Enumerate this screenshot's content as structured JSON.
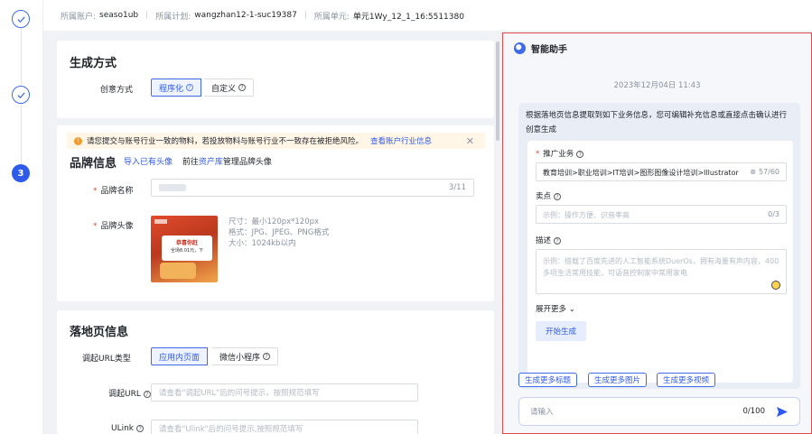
{
  "topbar": {
    "account_label": "所属账户:",
    "account_value": "seaso1ub",
    "plan_label": "所属计划:",
    "plan_value": "wangzhan12-1-suc19387",
    "unit_label": "所属单元:",
    "unit_value": "单元1Wy_12_1_16:5511380",
    "separator": "|"
  },
  "steps": [
    {
      "state": "done"
    },
    {
      "state": "done"
    },
    {
      "state": "current",
      "number": "3"
    }
  ],
  "generate": {
    "title": "生成方式",
    "creative_label": "创意方式",
    "options": [
      "程序化",
      "自定义"
    ],
    "selected": "程序化"
  },
  "brand": {
    "warning_text": "请您提交与账号行业一致的物料，若投放物料与账号行业不一致存在被拒绝风险。",
    "warning_link": "查看账户行业信息",
    "title": "品牌信息",
    "import_link": "导入已有头像",
    "goto_prefix": "前往",
    "goto_link": "资产库",
    "goto_suffix": "管理品牌头像",
    "name_label": "品牌名称",
    "name_count": "3/11",
    "avatar_label": "品牌头像",
    "avatar_image_text": [
      "恭喜你赶",
      "全场8.01元，下"
    ],
    "specs": [
      "尺寸：最小120px*120px",
      "格式：JPG、JPEG、PNG格式",
      "大小：1024kb以内"
    ]
  },
  "landing": {
    "title": "落地页信息",
    "url_type_label": "调起URL类型",
    "url_type_options": [
      "应用内页面",
      "微信小程序"
    ],
    "url_type_selected": "应用内页面",
    "url_label": "调起URL",
    "url_placeholder": "请查看\"调起URL\"后的问号提示，按照规范填写",
    "ulink_label": "ULink",
    "ulink_placeholder": "请查看\"Ulink\"后的问号提示,按照规范填写"
  },
  "assistant": {
    "title": "智能助手",
    "timestamp": "2023年12月04日 11:43",
    "message": "根据落地页信息提取到如下业务信息，您可编辑补充信息或直接点击确认进行创意生成",
    "business_label": "推广业务",
    "business_value": "教育培训>职业培训>IT培训>图形图像设计培训>Illustrator",
    "business_count": "57/60",
    "selling_label": "卖点",
    "selling_placeholder": "示例：操作方便、识音率高",
    "selling_count": "0/3",
    "desc_label": "描述",
    "desc_placeholder": "示例：搭载了百度先进的人工智能系统DuerOs，拥有海量有声内容，400多项生活常用技能，可语音控制家中常用家电",
    "expand_label": "展开更多",
    "start_button": "开始生成",
    "chips": [
      "生成更多标题",
      "生成更多图片",
      "生成更多视频"
    ],
    "input_placeholder": "请输入",
    "input_count": "0/100"
  },
  "colors": {
    "primary": "#2f5bea",
    "panel_border": "#e14a4a",
    "warning_bg": "#fff6e8",
    "required": "#e5483d"
  }
}
